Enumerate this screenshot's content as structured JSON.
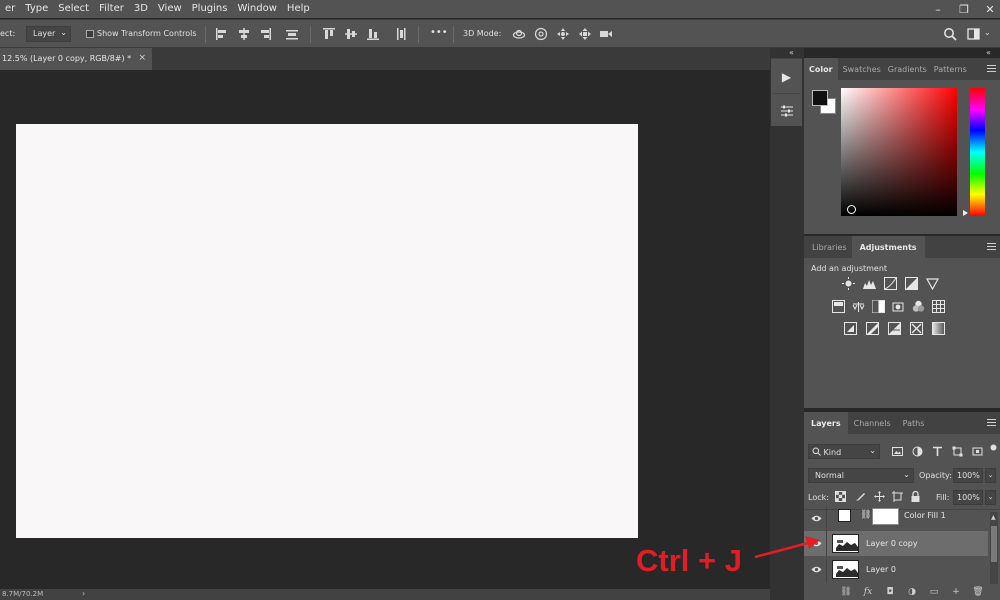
{
  "menubar": {
    "items": [
      "er",
      "Type",
      "Select",
      "Filter",
      "3D",
      "View",
      "Plugins",
      "Window",
      "Help"
    ],
    "window_controls": {
      "search": "search-icon",
      "minimize": "–",
      "restore": "❐",
      "close": "✕"
    }
  },
  "options": {
    "select_label": "ect:",
    "select_value": "Layer",
    "show_transform": "Show Transform Controls",
    "more": "•••",
    "mode_3d": "3D Mode:"
  },
  "document": {
    "tab_title": "12.5% (Layer 0 copy, RGB/8#) *",
    "close": "×",
    "status": "8.7M/70.2M",
    "status_chevron": "›"
  },
  "dock": {
    "collapse": "«"
  },
  "color_panel": {
    "tabs": [
      "Color",
      "Swatches",
      "Gradients",
      "Patterns"
    ],
    "active": "Color",
    "foreground": "#111111",
    "background": "#ffffff",
    "field_hue": "#ff0000"
  },
  "adjust_panel": {
    "tabs": [
      "Libraries",
      "Adjustments"
    ],
    "active": "Adjustments",
    "title": "Add an adjustment"
  },
  "layers_panel": {
    "tabs": [
      "Layers",
      "Channels",
      "Paths"
    ],
    "active": "Layers",
    "kind": "Kind",
    "blend_mode": "Normal",
    "opacity_label": "Opacity:",
    "opacity_value": "100%",
    "lock_label": "Lock:",
    "fill_label": "Fill:",
    "fill_value": "100%",
    "layers": [
      {
        "name": "Color Fill 1",
        "selected": false
      },
      {
        "name": "Layer 0 copy",
        "selected": true
      },
      {
        "name": "Layer 0",
        "selected": false
      }
    ],
    "footer": [
      "⛓",
      "fx",
      "◘",
      "◑",
      "▭",
      "+",
      "🗑"
    ]
  },
  "annotation": {
    "text": "Ctrl + J",
    "color": "#e21d25"
  }
}
